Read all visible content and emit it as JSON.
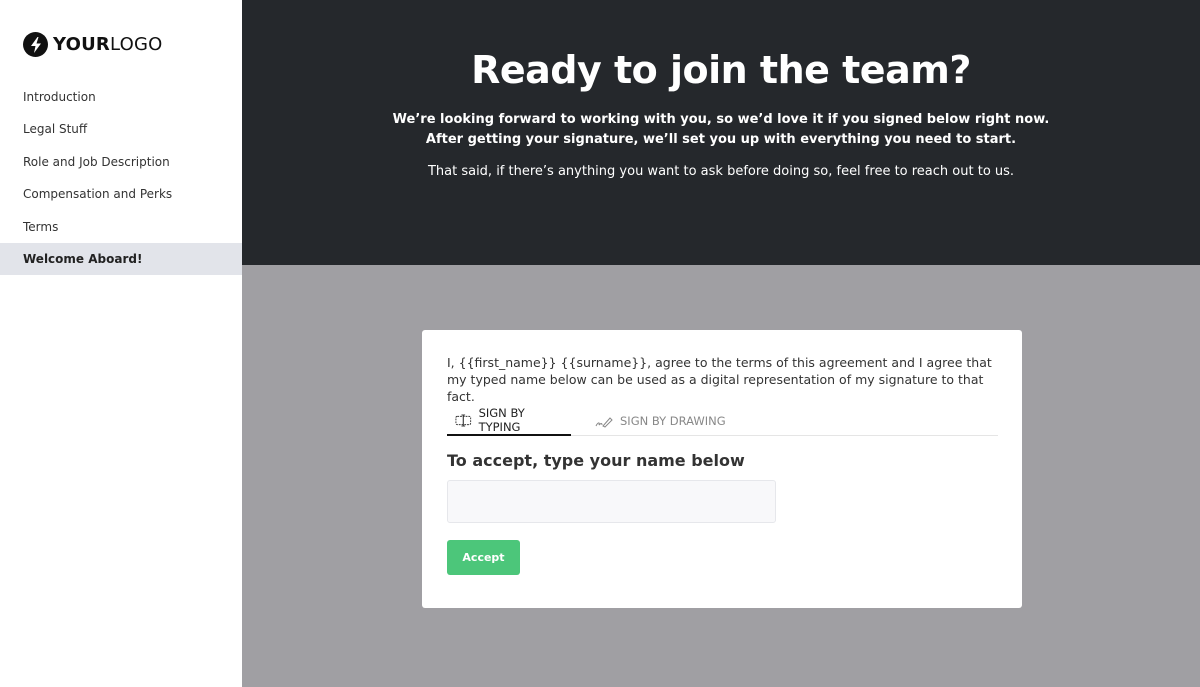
{
  "logo": {
    "bold": "YOUR",
    "light": "LOGO",
    "icon": "lightning-bolt-icon"
  },
  "sidebar": {
    "items": [
      {
        "label": "Introduction",
        "active": false
      },
      {
        "label": "Legal Stuff",
        "active": false
      },
      {
        "label": "Role and Job Description",
        "active": false
      },
      {
        "label": "Compensation and Perks",
        "active": false
      },
      {
        "label": "Terms",
        "active": false
      },
      {
        "label": "Welcome Aboard!",
        "active": true
      }
    ]
  },
  "hero": {
    "title": "Ready to join the team?",
    "subtitle_line1": "We’re looking forward to working with you, so we’d love it if you signed below right now.",
    "subtitle_line2": "After getting your signature, we’ll set you up with everything you need to start.",
    "note": "That said, if there’s anything you want to ask before doing so, feel free to reach out to us."
  },
  "signature": {
    "agreement": "I, {{first_name}} {{surname}}, agree to the terms of this agreement and I agree that my typed name below can be used as a digital representation of my signature to that fact.",
    "tabs": [
      {
        "label": "SIGN BY TYPING",
        "icon": "text-cursor-box-icon",
        "active": true
      },
      {
        "label": "SIGN BY DRAWING",
        "icon": "pen-signature-icon",
        "active": false
      }
    ],
    "accept_label": "To accept, type your name below",
    "name_input": {
      "value": "",
      "placeholder": ""
    },
    "accept_button": "Accept"
  },
  "colors": {
    "hero_bg": "#25282c",
    "page_bg": "#a09fa3",
    "active_nav_bg": "#e2e4ea",
    "accept_button": "#4cc67a"
  }
}
